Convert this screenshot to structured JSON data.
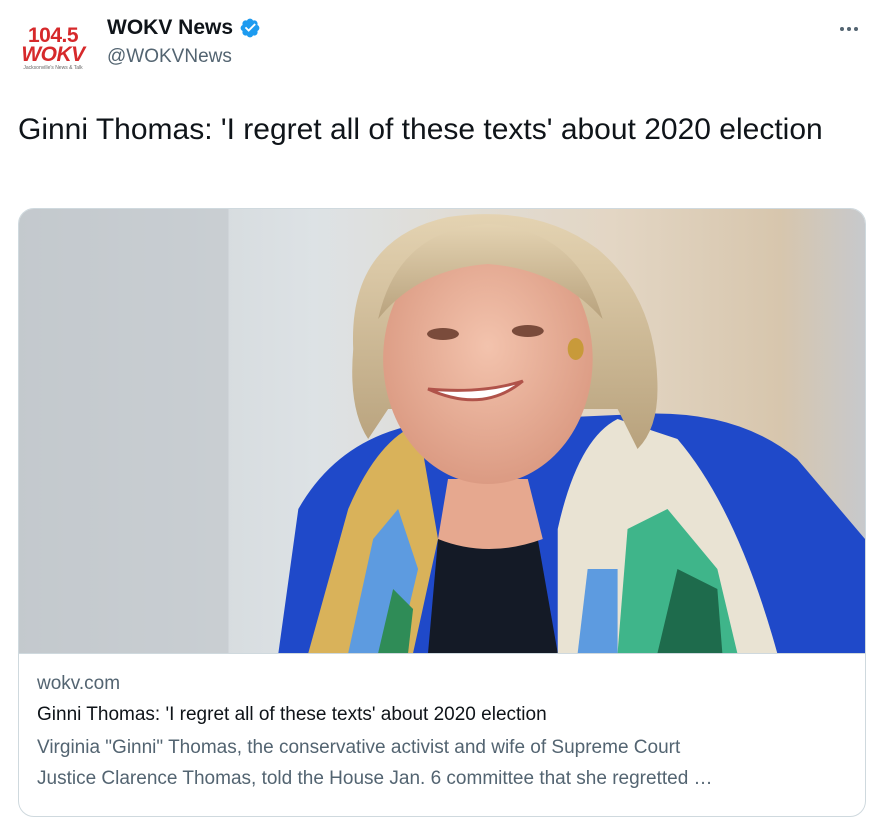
{
  "author": {
    "display_name": "WOKV News",
    "handle": "@WOKVNews",
    "verified_icon": "verified-badge-icon",
    "avatar_logo": {
      "frequency": "104.5",
      "call_sign": "WOKV",
      "tagline": "Jacksonville's News & Talk"
    }
  },
  "menu": {
    "icon": "more-horizontal-icon"
  },
  "tweet": {
    "text": "Ginni Thomas: 'I regret all of these texts' about 2020 election"
  },
  "card": {
    "image_subject": "photo",
    "domain": "wokv.com",
    "title": "Ginni Thomas: 'I regret all of these texts' about 2020 election",
    "description_line1": "Virginia \"Ginni\" Thomas, the conservative activist and wife of Supreme Court",
    "description_line2": "Justice Clarence Thomas, told the House Jan. 6 committee that she regretted …"
  },
  "colors": {
    "text_primary": "#0f1419",
    "text_secondary": "#536471",
    "verified_blue": "#1d9bf0",
    "border": "#cfd9de",
    "logo_red": "#d6292b"
  }
}
